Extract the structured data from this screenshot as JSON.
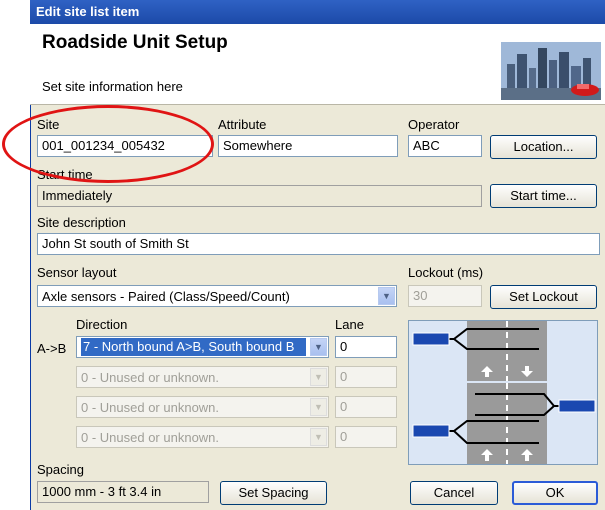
{
  "window": {
    "title": "Edit site list item"
  },
  "header": {
    "title": "Roadside Unit Setup",
    "subtitle": "Set site information here"
  },
  "site": {
    "label": "Site",
    "value": "001_001234_005432"
  },
  "attribute": {
    "label": "Attribute",
    "value": "Somewhere"
  },
  "operator": {
    "label": "Operator",
    "value": "ABC"
  },
  "buttons": {
    "location": "Location...",
    "start_time": "Start time...",
    "set_lockout": "Set Lockout",
    "set_spacing": "Set Spacing",
    "cancel": "Cancel",
    "ok": "OK"
  },
  "start_time": {
    "label": "Start time",
    "value": "Immediately"
  },
  "description": {
    "label": "Site description",
    "value": "John St south of Smith St"
  },
  "sensor_layout": {
    "label": "Sensor layout",
    "value": "Axle sensors - Paired (Class/Speed/Count)"
  },
  "lockout": {
    "label": "Lockout (ms)",
    "value": "30"
  },
  "direction": {
    "header": "Direction",
    "lane_header": "Lane",
    "row_label": "A->B",
    "rows": [
      {
        "value": "7 - North bound A>B, South bound B",
        "lane": "0"
      },
      {
        "value": "0 - Unused or unknown.",
        "lane": "0"
      },
      {
        "value": "0 - Unused or unknown.",
        "lane": "0"
      },
      {
        "value": "0 - Unused or unknown.",
        "lane": "0"
      }
    ]
  },
  "spacing": {
    "label": "Spacing",
    "value": "1000 mm - 3 ft 3.4 in"
  },
  "colors": {
    "accent": "#316ac5",
    "annotation": "#e01414",
    "titlebar": "#1c4aa8"
  }
}
